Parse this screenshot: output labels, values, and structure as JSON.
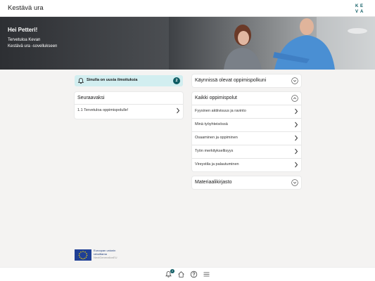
{
  "header": {
    "app_title": "Kestävä ura",
    "logo_text": "KEVA",
    "logo_icon": "keva-logo"
  },
  "hero": {
    "greeting": "Hei Petteri!",
    "welcome_line1": "Tervetuloa Kevan",
    "welcome_line2": "Kestävä ura -sovellukseen"
  },
  "notification": {
    "text": "Sinulla on uusia ilmoituksia",
    "count": "2",
    "icon": "bell-icon"
  },
  "next_up": {
    "title": "Seuraavaksi",
    "items": [
      {
        "label": "1.1 Tervetuloa oppimispolulle!"
      }
    ]
  },
  "ongoing": {
    "title": "Käynnissä olevat oppimispolkuni",
    "icon": "chevron-circle-down-icon"
  },
  "all_paths": {
    "title": "Kaikki oppimispolut",
    "icon": "chevron-circle-up-icon",
    "items": [
      {
        "label": "Fyysinen aktiivisuus ja ravinto"
      },
      {
        "label": "Minä työyhteisössä"
      },
      {
        "label": "Osaaminen ja oppiminen"
      },
      {
        "label": "Työn merkityksellisyys"
      },
      {
        "label": "Vireystila ja palautuminen"
      }
    ]
  },
  "materials": {
    "title": "Materiaalikirjasto",
    "icon": "chevron-circle-down-icon"
  },
  "eu": {
    "line1": "Euroopan unionin",
    "line2": "rahoittama",
    "line3": "NextGenerationEU"
  },
  "bottom_nav": {
    "notifications_badge": "2",
    "icons": [
      "bell-icon",
      "home-icon",
      "help-icon",
      "menu-icon"
    ]
  },
  "colors": {
    "accent": "#0e5c63",
    "notification_bg": "#d2eef0",
    "background": "#f4f3f2"
  }
}
